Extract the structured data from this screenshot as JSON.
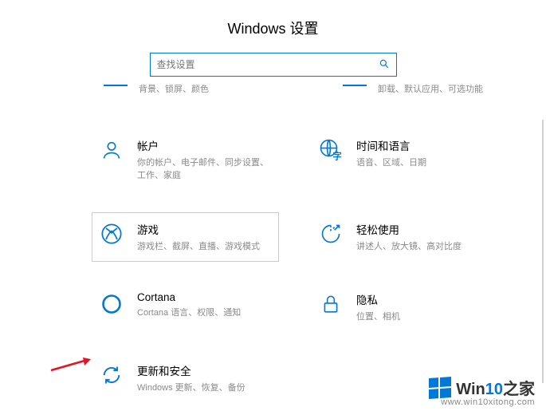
{
  "page_title": "Windows 设置",
  "search": {
    "placeholder": "查找设置"
  },
  "cutoff": {
    "left_desc": "背景、锁屏、颜色",
    "right_desc": "卸载、默认应用、可选功能"
  },
  "tiles": {
    "accounts": {
      "title": "帐户",
      "desc": "你的帐户、电子邮件、同步设置、工作、家庭"
    },
    "time_language": {
      "title": "时间和语言",
      "desc": "语音、区域、日期"
    },
    "gaming": {
      "title": "游戏",
      "desc": "游戏栏、截屏、直播、游戏模式"
    },
    "ease_of_access": {
      "title": "轻松使用",
      "desc": "讲述人、放大镜、高对比度"
    },
    "cortana": {
      "title": "Cortana",
      "desc": "Cortana 语言、权限、通知"
    },
    "privacy": {
      "title": "隐私",
      "desc": "位置、相机"
    },
    "update_security": {
      "title": "更新和安全",
      "desc": "Windows 更新、恢复、备份"
    }
  },
  "watermark": {
    "brand_prefix": "Win",
    "brand_highlight": "10",
    "brand_suffix": "之家",
    "url": "www.win10xitong.com"
  }
}
